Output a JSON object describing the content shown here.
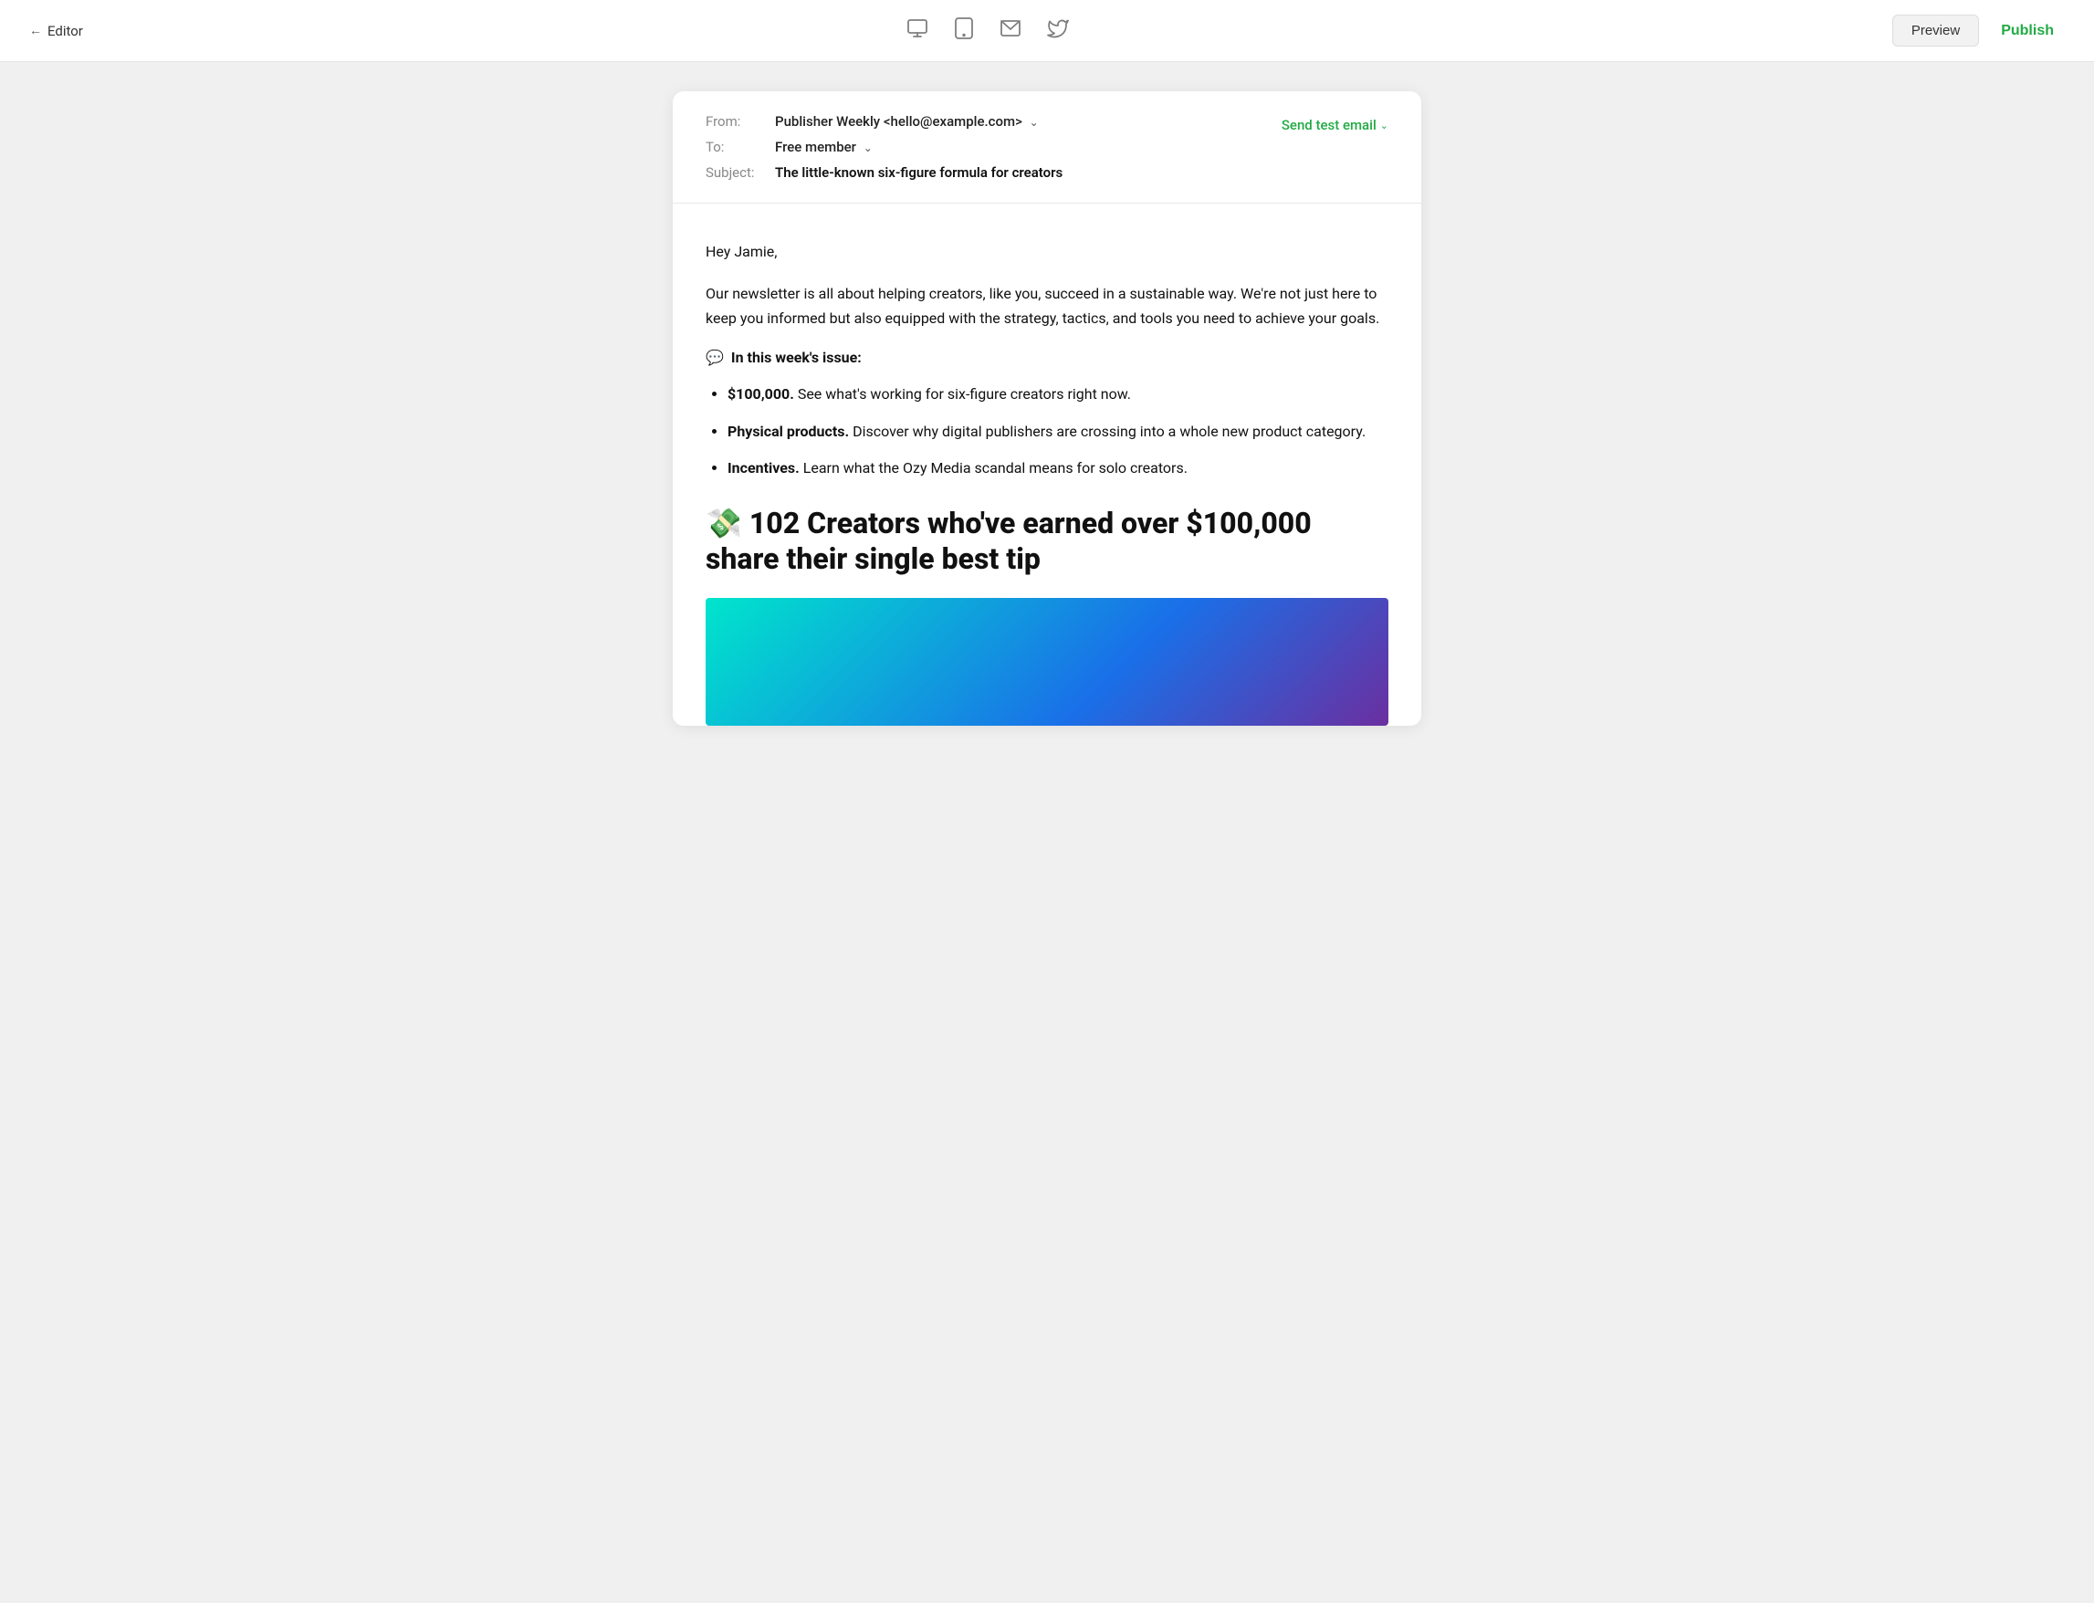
{
  "toolbar": {
    "back_label": "Editor",
    "preview_label": "Preview",
    "publish_label": "Publish",
    "icons": [
      {
        "name": "desktop-icon",
        "symbol": "🖥",
        "label": "Desktop view"
      },
      {
        "name": "tablet-icon",
        "symbol": "📱",
        "label": "Tablet view"
      },
      {
        "name": "email-icon",
        "symbol": "✉",
        "label": "Email view"
      },
      {
        "name": "twitter-icon",
        "symbol": "🐦",
        "label": "Twitter view"
      }
    ]
  },
  "email_meta": {
    "from_label": "From:",
    "from_value": "Publisher Weekly <hello@example.com>",
    "to_label": "To:",
    "to_value": "Free member",
    "subject_label": "Subject:",
    "subject_value": "The little-known six-figure formula for creators",
    "send_test_email_label": "Send test email"
  },
  "email_body": {
    "greeting": "Hey Jamie,",
    "intro_paragraph": "Our newsletter is all about helping creators, like you, succeed in a sustainable way. We're not just here to keep you informed but also equipped with the strategy, tactics, and tools you need to achieve your goals.",
    "section_emoji": "💬",
    "section_header": "In this week's issue:",
    "bullets": [
      {
        "bold": "$100,000.",
        "text": " See what's working for six-figure creators right now."
      },
      {
        "bold": "Physical products.",
        "text": " Discover why digital publishers are crossing into a whole new product category."
      },
      {
        "bold": "Incentives.",
        "text": " Learn what the Ozy Media scandal means for solo creators."
      }
    ],
    "article_emoji": "💸",
    "article_title": "102 Creators who've earned over $100,000 share their single best tip"
  }
}
